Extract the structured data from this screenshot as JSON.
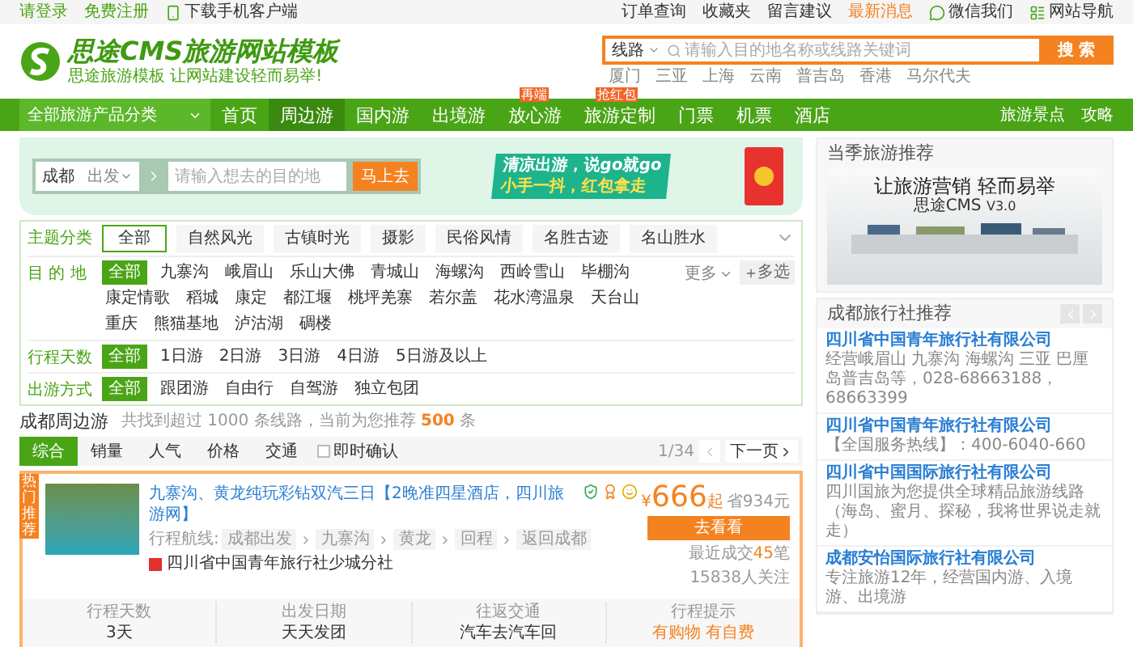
{
  "top_bar": {
    "left": [
      {
        "kind": "link",
        "label": "请登录"
      },
      {
        "kind": "link",
        "label": "免费注册"
      },
      {
        "kind": "phone",
        "label": "下载手机客户端"
      }
    ],
    "right": [
      {
        "kind": "plain",
        "label": "订单查询"
      },
      {
        "kind": "plain",
        "label": "收藏夹"
      },
      {
        "kind": "plain",
        "label": "留言建议"
      },
      {
        "kind": "hot",
        "label": "最新消息"
      },
      {
        "kind": "wechat",
        "label": "微信我们"
      },
      {
        "kind": "sitemap",
        "label": "网站导航"
      }
    ]
  },
  "header": {
    "title": "思途CMS旅游网站模板",
    "subtitle": "思途旅游模板 让网站建设轻而易举!",
    "search": {
      "type": "线路",
      "placeholder": "请输入目的地名称或线路关键词",
      "button": "搜 索",
      "hot_words": [
        "厦门",
        "三亚",
        "上海",
        "云南",
        "普吉岛",
        "香港",
        "马尔代夫"
      ]
    }
  },
  "nav": {
    "category": "全部旅游产品分类",
    "items": [
      {
        "label": "首页",
        "selected": false
      },
      {
        "label": "周边游",
        "selected": true
      },
      {
        "label": "国内游",
        "selected": false
      },
      {
        "label": "出境游",
        "selected": false
      },
      {
        "label": "放心游",
        "selected": false,
        "badge": "再端"
      },
      {
        "label": "旅游定制",
        "selected": false,
        "badge": "抢红包"
      },
      {
        "label": "门票",
        "selected": false
      },
      {
        "label": "机票",
        "selected": false
      },
      {
        "label": "酒店",
        "selected": false
      }
    ],
    "right": [
      "旅游景点",
      "攻略"
    ]
  },
  "banner": {
    "from": "成都",
    "from_type": "出发",
    "placeholder": "请输入想去的目的地",
    "button": "马上去",
    "slogan_1": "清凉出游，说go就go",
    "slogan_2": "小手一抖，红包拿走"
  },
  "filters": [
    {
      "label": "主题分类",
      "kind": "boxed",
      "options": [
        {
          "label": "全部",
          "selected": true
        },
        {
          "label": "自然风光",
          "selected": false
        },
        {
          "label": "古镇时光",
          "selected": false
        },
        {
          "label": "摄影",
          "selected": false
        },
        {
          "label": "民俗风情",
          "selected": false
        },
        {
          "label": "名胜古迹",
          "selected": false
        },
        {
          "label": "名山胜水",
          "selected": false
        }
      ]
    },
    {
      "label": "目 的 地",
      "kind": "plain",
      "more": "更多",
      "multi": "多选",
      "options": [
        {
          "label": "全部",
          "selected": true
        },
        {
          "label": "九寨沟",
          "selected": false
        },
        {
          "label": "峨眉山",
          "selected": false
        },
        {
          "label": "乐山大佛",
          "selected": false
        },
        {
          "label": "青城山",
          "selected": false
        },
        {
          "label": "海螺沟",
          "selected": false
        },
        {
          "label": "西岭雪山",
          "selected": false
        },
        {
          "label": "毕棚沟",
          "selected": false
        },
        {
          "label": "康定情歌",
          "selected": false
        },
        {
          "label": "稻城",
          "selected": false
        },
        {
          "label": "康定",
          "selected": false
        },
        {
          "label": "都江堰",
          "selected": false
        },
        {
          "label": "桃坪羌寨",
          "selected": false
        },
        {
          "label": "若尔盖",
          "selected": false
        },
        {
          "label": "花水湾温泉",
          "selected": false
        },
        {
          "label": "天台山",
          "selected": false
        },
        {
          "label": "重庆",
          "selected": false
        },
        {
          "label": "熊猫基地",
          "selected": false
        },
        {
          "label": "泸沽湖",
          "selected": false
        },
        {
          "label": "碉楼",
          "selected": false
        }
      ]
    },
    {
      "label": "行程天数",
      "kind": "plain",
      "options": [
        {
          "label": "全部",
          "selected": true
        },
        {
          "label": "1日游",
          "selected": false
        },
        {
          "label": "2日游",
          "selected": false
        },
        {
          "label": "3日游",
          "selected": false
        },
        {
          "label": "4日游",
          "selected": false
        },
        {
          "label": "5日游及以上",
          "selected": false
        }
      ]
    },
    {
      "label": "出游方式",
      "kind": "plain",
      "options": [
        {
          "label": "全部",
          "selected": true
        },
        {
          "label": "跟团游",
          "selected": false
        },
        {
          "label": "自由行",
          "selected": false
        },
        {
          "label": "自驾游",
          "selected": false
        },
        {
          "label": "独立包团",
          "selected": false
        }
      ]
    }
  ],
  "list": {
    "title": "成都周边游",
    "summary": "共找到超过 1000 条线路，当前为您推荐 **500** 条",
    "sort_tabs": [
      {
        "label": "综合",
        "selected": true
      },
      {
        "label": "销量",
        "selected": false
      },
      {
        "label": "人气",
        "selected": false
      },
      {
        "label": "价格",
        "selected": false
      },
      {
        "label": "交通",
        "selected": false
      }
    ],
    "instant_confirm": {
      "label": "即时确认",
      "checked": false
    },
    "page": "1/34",
    "next": "下一页"
  },
  "product": {
    "ribbon": "热门推荐",
    "title": "九寨沟、黄龙纯玩彩钻双汽三日【2晚准四星酒店，四川旅游网】",
    "route_label": "行程航线:",
    "route": [
      "成都出发",
      "九寨沟",
      "黄龙",
      "回程",
      "返回成都"
    ],
    "agency": "四川省中国青年旅行社少城分社",
    "currency": "¥",
    "price": "666",
    "price_suffix": "起",
    "saving": "省934元",
    "button": "去看看",
    "sales_prefix": "最近成交",
    "sales": "45",
    "sales_suffix": "笔",
    "followers": "15838人关注",
    "facts": [
      {
        "label": "行程天数",
        "value": "3天",
        "kind": "plain"
      },
      {
        "label": "出发日期",
        "value": "天天发团",
        "kind": "plain"
      },
      {
        "label": "往返交通",
        "value": "汽车去汽车回",
        "kind": "plain"
      },
      {
        "label": "行程提示",
        "value": "有购物 有自费",
        "kind": "warning"
      }
    ]
  },
  "sidebar": {
    "season": {
      "title": "当季旅游推荐",
      "headline": "让旅游营销 轻而易举",
      "brand": "思途CMS",
      "version": "V3.0"
    },
    "agencies": {
      "title": "成都旅行社推荐",
      "items": [
        {
          "name": "四川省中国青年旅行社有限公司",
          "desc": "经营峨眉山 九寨沟 海螺沟 三亚 巴厘岛普吉岛等，028-68663188，68663399"
        },
        {
          "name": "四川省中国青年旅行社有限公司",
          "desc": "【全国服务热线】：400-6040-660"
        },
        {
          "name": "四川省中国国际旅行社有限公司",
          "desc": "四川国旅为您提供全球精品旅游线路（海岛、蜜月、探秘，我将世界说走就走）"
        },
        {
          "name": "成都安怡国际旅行社有限公司",
          "desc": "专注旅游12年，经营国内游、入境游、出境游"
        }
      ]
    }
  }
}
